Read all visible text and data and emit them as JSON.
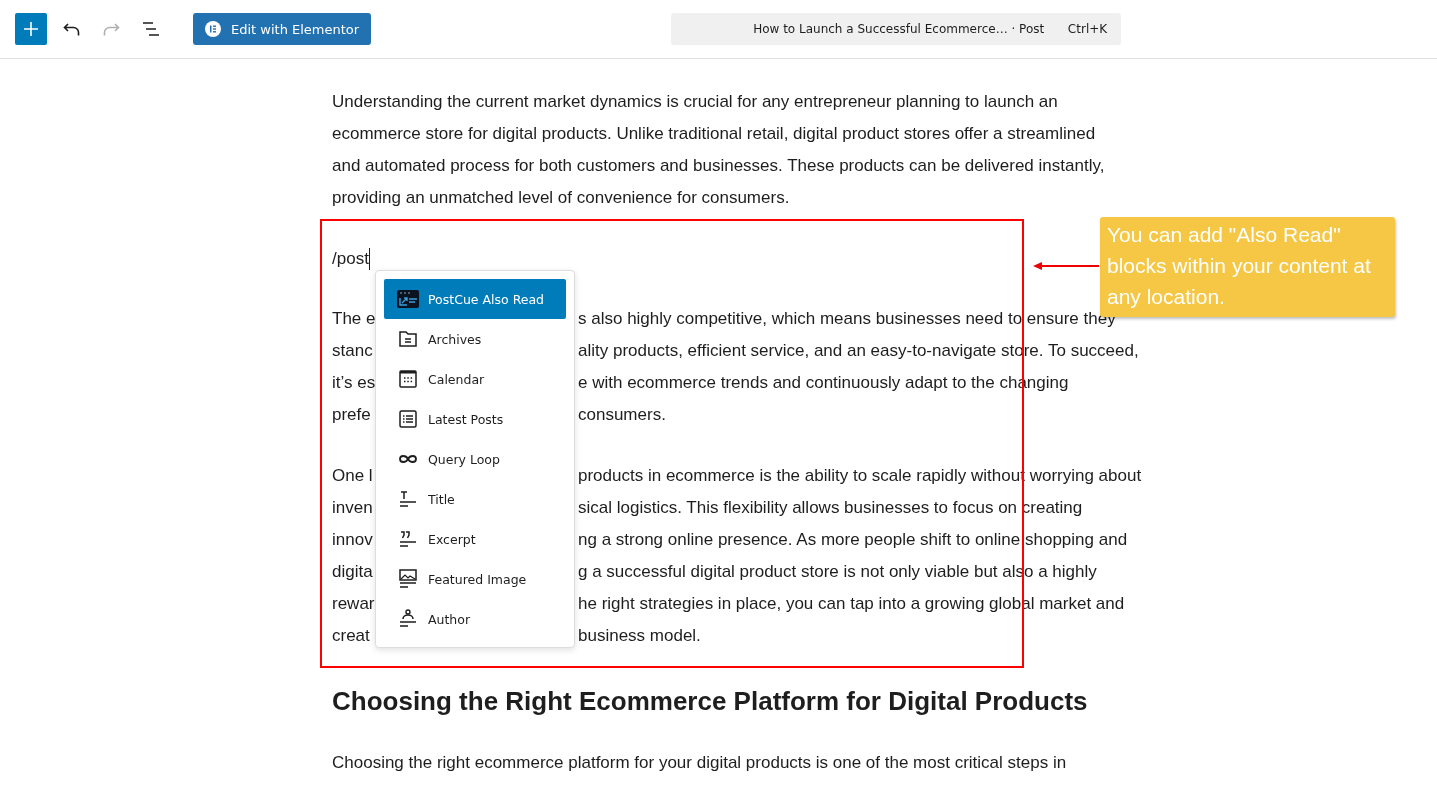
{
  "toolbar": {
    "buttons": [
      {
        "kind": "add",
        "disabled": false
      },
      {
        "kind": "undo",
        "disabled": false
      },
      {
        "kind": "redo",
        "disabled": true
      },
      {
        "kind": "outline",
        "disabled": false
      }
    ],
    "elementor_button": "Edit with Elementor",
    "command_bar": {
      "title": "How to Launch a Successful Ecommerce… · Post",
      "shortcut": "Ctrl+K"
    }
  },
  "content": {
    "blocks": [
      {
        "kind": "paragraph",
        "lines": [
          {
            "left": "Understanding the current market dynamics is crucial for any entrepreneur planning to launch an"
          },
          {
            "left": "ecommerce store for digital products. Unlike traditional retail, digital product stores offer a streamlined"
          },
          {
            "left": "and automated process for both customers and businesses. These products can be delivered instantly,"
          },
          {
            "left": "providing an unmatched level of convenience for consumers."
          }
        ]
      },
      {
        "kind": "slash",
        "text": "/post"
      },
      {
        "kind": "paragraph",
        "lines": [
          {
            "left": "The e",
            "right": "s also highly competitive, which means businesses need to ensure they"
          },
          {
            "left": "stanc",
            "right": "ality products, efficient service, and an easy-to-navigate store. To succeed,"
          },
          {
            "left": "it’s es",
            "right": "e with ecommerce trends and continuously adapt to the changing"
          },
          {
            "left": "prefe",
            "right": "consumers."
          }
        ]
      },
      {
        "kind": "paragraph",
        "lines": [
          {
            "left": "One l",
            "right": "products in ecommerce is the ability to scale rapidly without worrying about"
          },
          {
            "left": "inven",
            "right": "sical logistics. This flexibility allows businesses to focus on creating"
          },
          {
            "left": "innov",
            "right": "ng a strong online presence. As more people shift to online shopping and"
          },
          {
            "left": "digita",
            "right": "g a successful digital product store is not only viable but also a highly"
          },
          {
            "left": "rewar",
            "right": "he right strategies in place, you can tap into a growing global market and"
          },
          {
            "left": "creat",
            "right": "business model."
          }
        ]
      },
      {
        "kind": "heading",
        "text": "Choosing the Right Ecommerce Platform for Digital Products"
      },
      {
        "kind": "paragraph",
        "lines": [
          {
            "left": "Choosing the right ecommerce platform for your digital products is one of the most critical steps in"
          }
        ]
      }
    ]
  },
  "block_menu": {
    "items": [
      {
        "label": "PostCue Also Read",
        "selected": true
      },
      {
        "label": "Archives",
        "selected": false
      },
      {
        "label": "Calendar",
        "selected": false
      },
      {
        "label": "Latest Posts",
        "selected": false
      },
      {
        "label": "Query Loop",
        "selected": false
      },
      {
        "label": "Title",
        "selected": false
      },
      {
        "label": "Excerpt",
        "selected": false
      },
      {
        "label": "Featured Image",
        "selected": false
      },
      {
        "label": "Author",
        "selected": false
      }
    ]
  },
  "annotation": {
    "callout": "You can add \"Also Read\" blocks within your content at any location."
  }
}
